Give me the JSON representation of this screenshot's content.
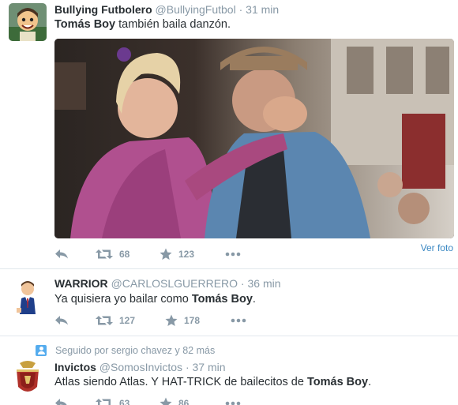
{
  "tweets": [
    {
      "fullname": "Bullying Futbolero",
      "screenname": "@BullyingFutbol",
      "separator": "·",
      "time": "31 min",
      "text_parts": [
        "Tomás Boy",
        " también baila danzón."
      ],
      "media_link": "Ver foto",
      "retweets": "68",
      "favorites": "123",
      "avatar_icon": "cartoon-player-avatar"
    },
    {
      "fullname": "WARRIOR",
      "screenname": "@CARLOSLGUERRERO",
      "separator": "·",
      "time": "36 min",
      "text_parts": [
        "Ya quisiera yo bailar como ",
        "Tomás Boy",
        "."
      ],
      "retweets": "127",
      "favorites": "178",
      "avatar_icon": "cartoon-suit-avatar"
    },
    {
      "context": "Seguido por sergio chavez y 82 más",
      "fullname": "Invictos",
      "screenname": "@SomosInvictos",
      "separator": "·",
      "time": "37 min",
      "text_parts": [
        "Atlas siendo Atlas. Y HAT-TRICK de bailecitos de ",
        "Tomás Boy",
        "."
      ],
      "retweets": "63",
      "favorites": "86",
      "avatar_icon": "crest-avatar"
    }
  ],
  "colors": {
    "secondary_text": "#8899a6",
    "primary_text": "#292f33",
    "link": "#3b88c3",
    "accent": "#55acee",
    "divider": "#e1e8ed"
  }
}
